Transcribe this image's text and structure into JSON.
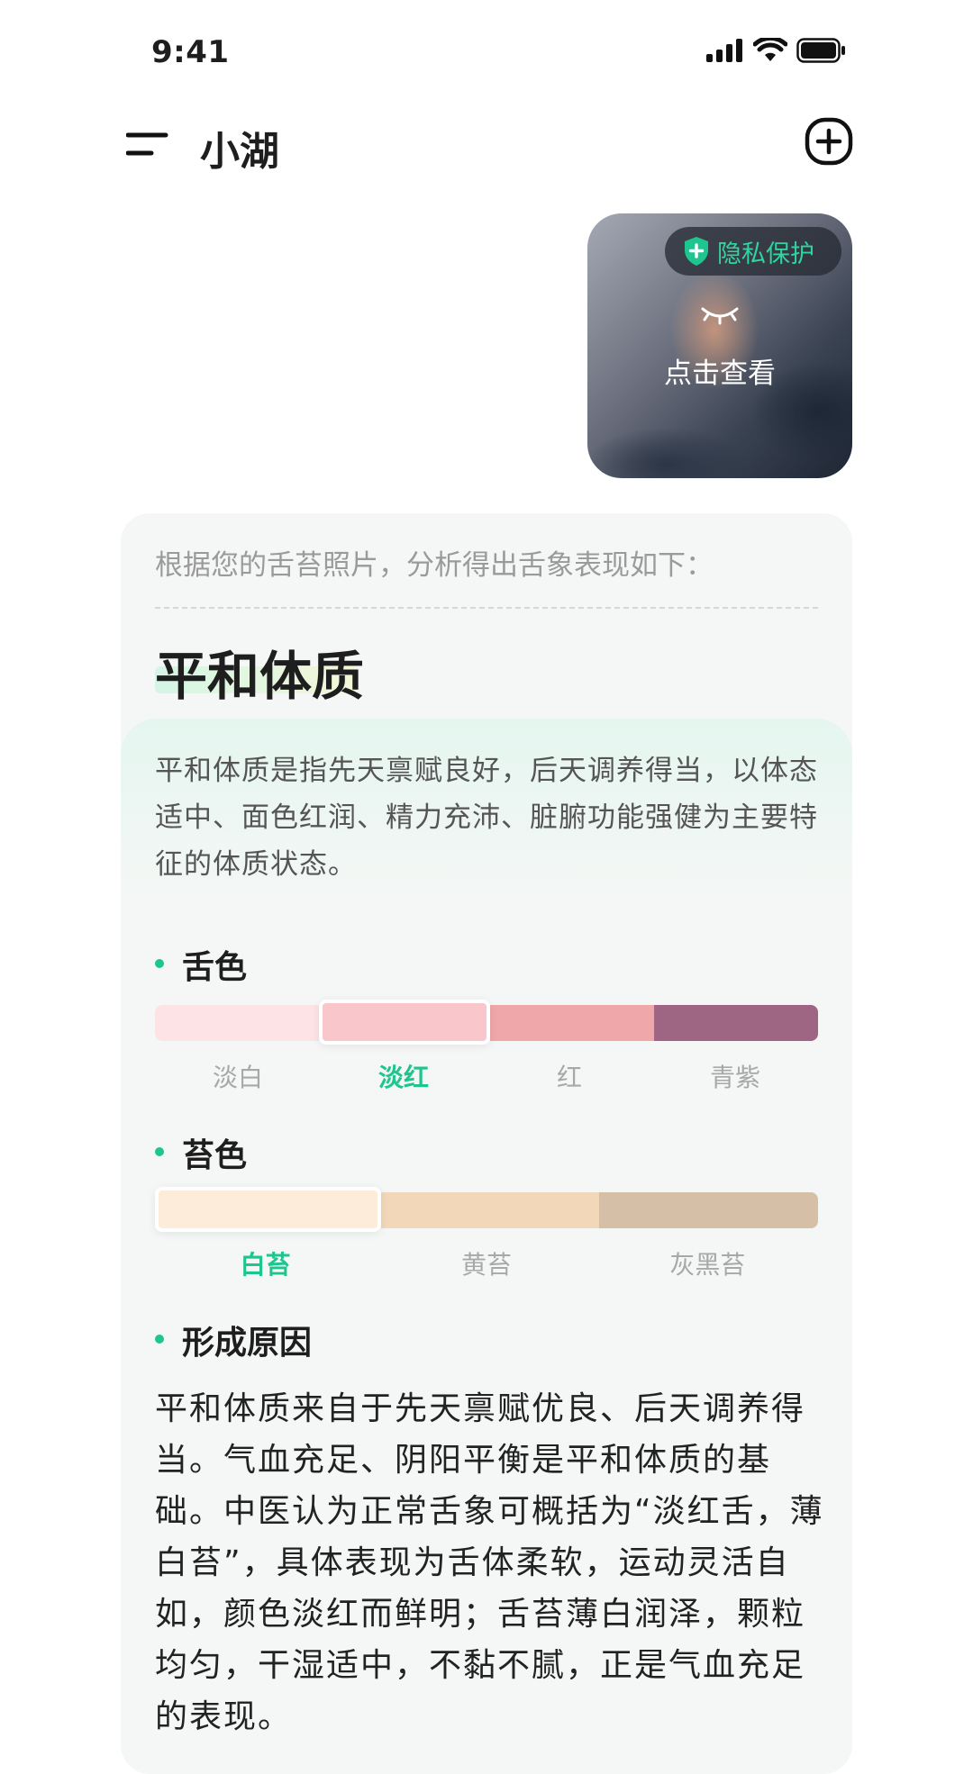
{
  "status_bar": {
    "time": "9:41"
  },
  "header": {
    "title": "小湖"
  },
  "photo_card": {
    "privacy_label": "隐私保护",
    "view_label": "点击查看"
  },
  "analysis": {
    "intro": "根据您的舌苔照片，分析得出舌象表现如下：",
    "constitution": "平和体质",
    "description": "平和体质是指先天禀赋良好，后天调养得当，以体态适中、面色红润、精力充沛、脏腑功能强健为主要特征的体质状态。",
    "tongue_color": {
      "title": "舌色",
      "options": [
        "淡白",
        "淡红",
        "红",
        "青紫"
      ],
      "colors": [
        "#fde3e6",
        "#f9c6cb",
        "#f0a7a9",
        "#9e6683"
      ],
      "selected_index": 1
    },
    "coating_color": {
      "title": "苔色",
      "options": [
        "白苔",
        "黄苔",
        "灰黑苔"
      ],
      "colors": [
        "#fdecd9",
        "#f2d8b8",
        "#d5bfa7"
      ],
      "selected_index": 0
    },
    "cause": {
      "title": "形成原因",
      "text": "平和体质来自于先天禀赋优良、后天调养得当。气血充足、阴阳平衡是平和体质的基础。中医认为正常舌象可概括为“淡红舌，薄白苔”，具体表现为舌体柔软，运动灵活自如，颜色淡红而鲜明；舌苔薄白润泽，颗粒均匀，干湿适中，不黏不腻，正是气血充足的表现。"
    }
  },
  "colors": {
    "accent": "#1ec58e",
    "privacy_green": "#2fd4a0"
  }
}
